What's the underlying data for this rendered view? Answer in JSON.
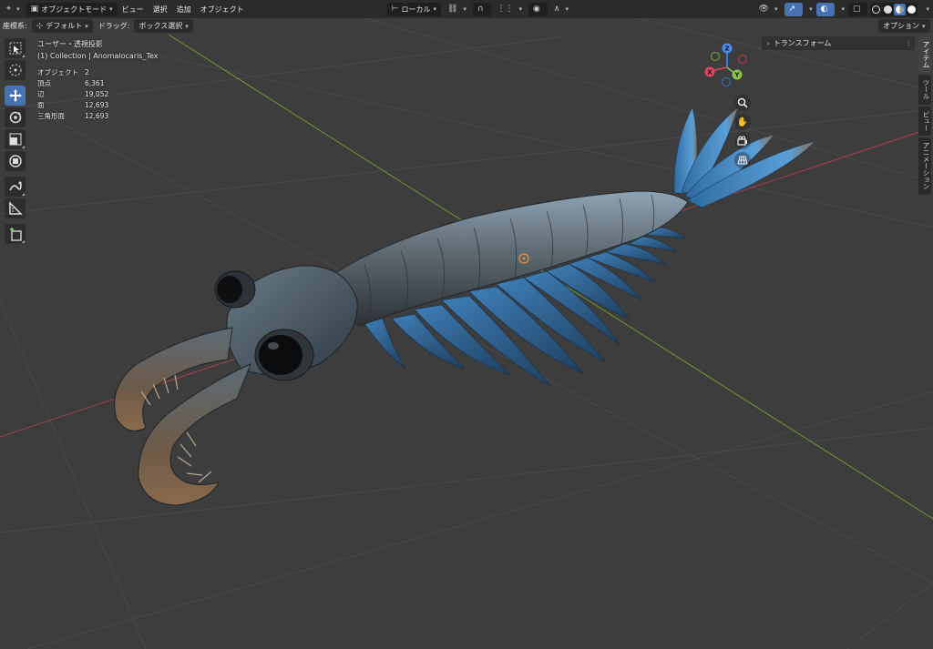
{
  "header": {
    "editor_icon": "editor-type-icon",
    "mode": "オブジェクトモード",
    "menus": [
      "ビュー",
      "選択",
      "追加",
      "オブジェクト"
    ],
    "transform_orientation": "ローカル",
    "colors": {
      "accent": "#4772b3",
      "bar": "#2b2b2b",
      "button": "#1f1f1f"
    }
  },
  "tool_settings": {
    "orientation_label": "座標系:",
    "orientation_value": "デフォルト",
    "drag_label": "ドラッグ:",
    "drag_value": "ボックス選択",
    "options_label": "オプション"
  },
  "toolbar": {
    "tools": [
      {
        "icon": "select-box-icon",
        "active": false
      },
      {
        "icon": "cursor-icon",
        "active": false
      },
      {
        "icon": "move-icon",
        "active": true
      },
      {
        "icon": "rotate-icon",
        "active": false
      },
      {
        "icon": "scale-icon",
        "active": false
      },
      {
        "icon": "transform-icon",
        "active": false
      },
      {
        "icon": "annotate-icon",
        "active": false
      },
      {
        "icon": "measure-icon",
        "active": false
      },
      {
        "icon": "add-cube-icon",
        "active": false
      }
    ]
  },
  "viewport": {
    "view_name": "ユーザー・透視投影",
    "collection": "(1) Collection | Anomalocaris_Tex",
    "stats": [
      {
        "label": "オブジェクト",
        "value": "2"
      },
      {
        "label": "頂点",
        "value": "6,361"
      },
      {
        "label": "辺",
        "value": "19,052"
      },
      {
        "label": "面",
        "value": "12,693"
      },
      {
        "label": "三角形面",
        "value": "12,693"
      }
    ]
  },
  "gizmo": {
    "x_label": "X",
    "y_label": "Y",
    "z_label": "Z"
  },
  "sidebar": {
    "panel_title": "トランスフォーム",
    "tabs": [
      "アイテム",
      "ツール",
      "ビュー",
      "アニメーション"
    ],
    "active_tab": "アイテム"
  }
}
